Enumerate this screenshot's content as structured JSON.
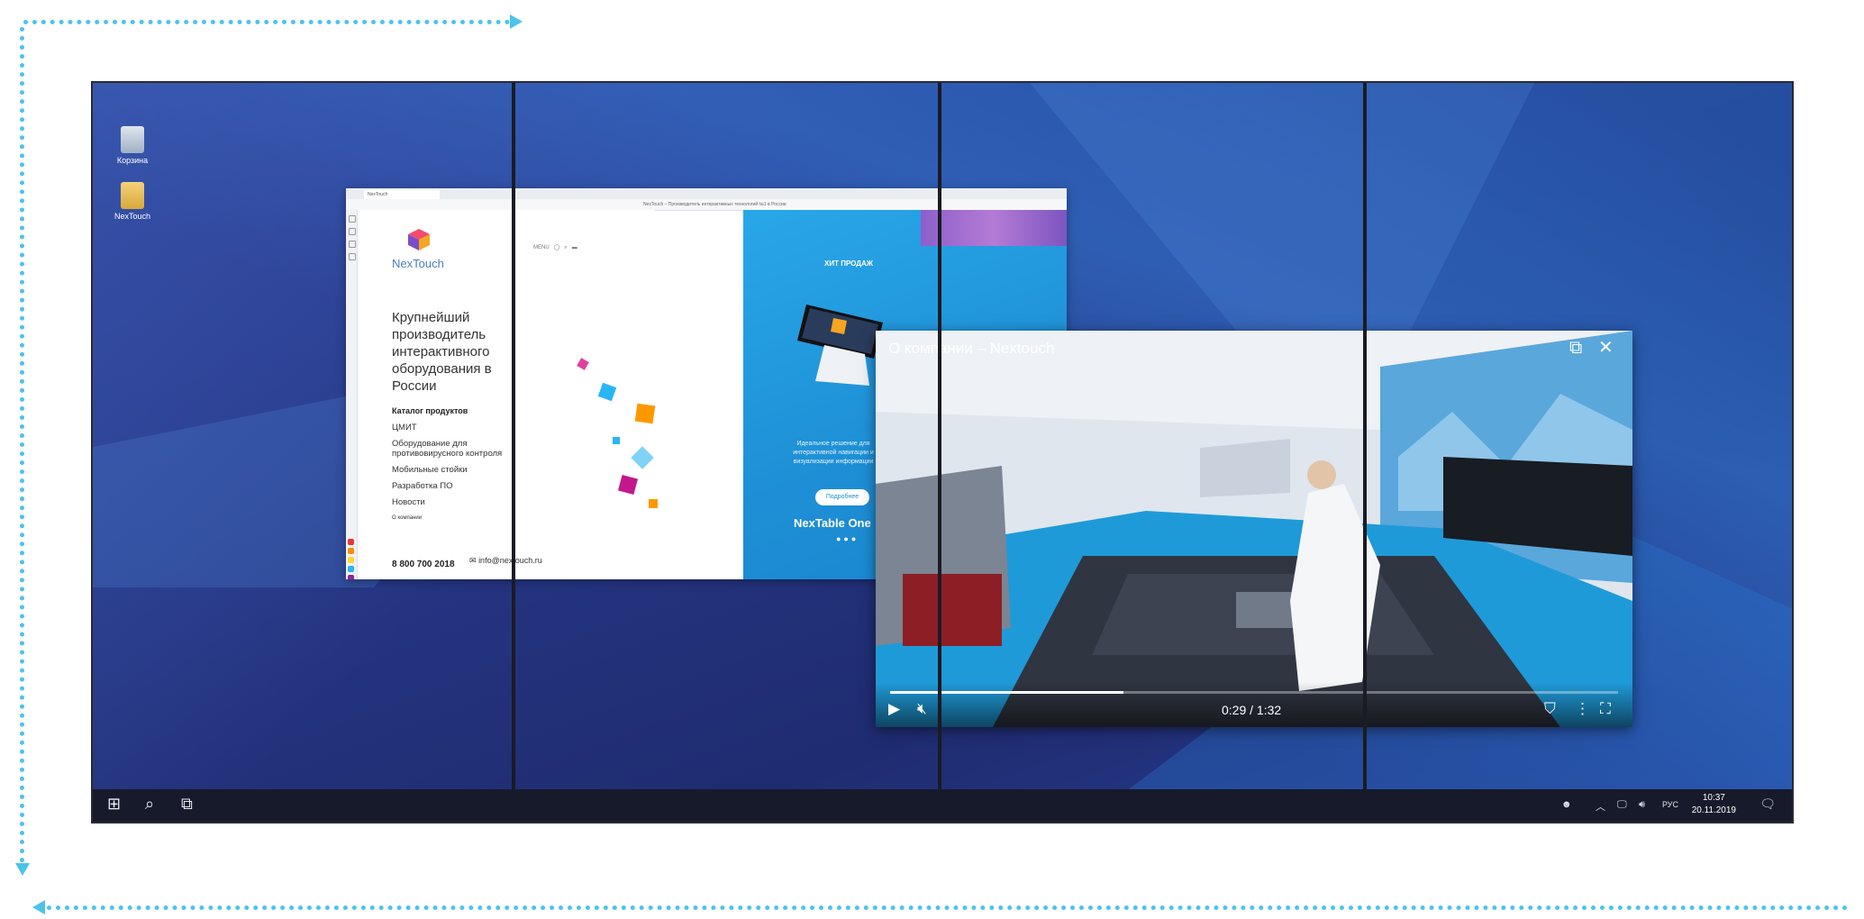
{
  "desktop": {
    "icons": [
      {
        "label": "Корзина",
        "icon": "recycle-bin-icon"
      },
      {
        "label": "NexTouch",
        "icon": "folder-icon"
      }
    ]
  },
  "browser": {
    "page_title": "NexTouch – Производитель интерактивных технологий №1 в России",
    "logo_text": "NexTouch",
    "hero_text": "Крупнейший производитель интерактивного оборудования в России",
    "catalog_title": "Каталог продуктов",
    "menu_items": [
      "ЦМИТ",
      "Оборудование для противовирусного контроля",
      "Мобильные стойки",
      "Разработка ПО",
      "Новости",
      "О компании"
    ],
    "phone": "8 800 700 2018",
    "email": "info@nextouch.ru",
    "hit_label": "ХИТ ПРОДАЖ",
    "ideal_text": "Идеальное решение для интерактивной навигации и визуализации информации",
    "more_button": "Подробнее",
    "product_name": "NexTable One",
    "colors": {
      "blue": "#1e8fd6",
      "logo": "#4a7fc1"
    }
  },
  "video": {
    "title": "О компании – Nextouch",
    "time": "0:29 / 1:32",
    "progress": 0.32
  },
  "taskbar": {
    "lang": "РУС",
    "time": "10:37",
    "date": "20.11.2019"
  }
}
